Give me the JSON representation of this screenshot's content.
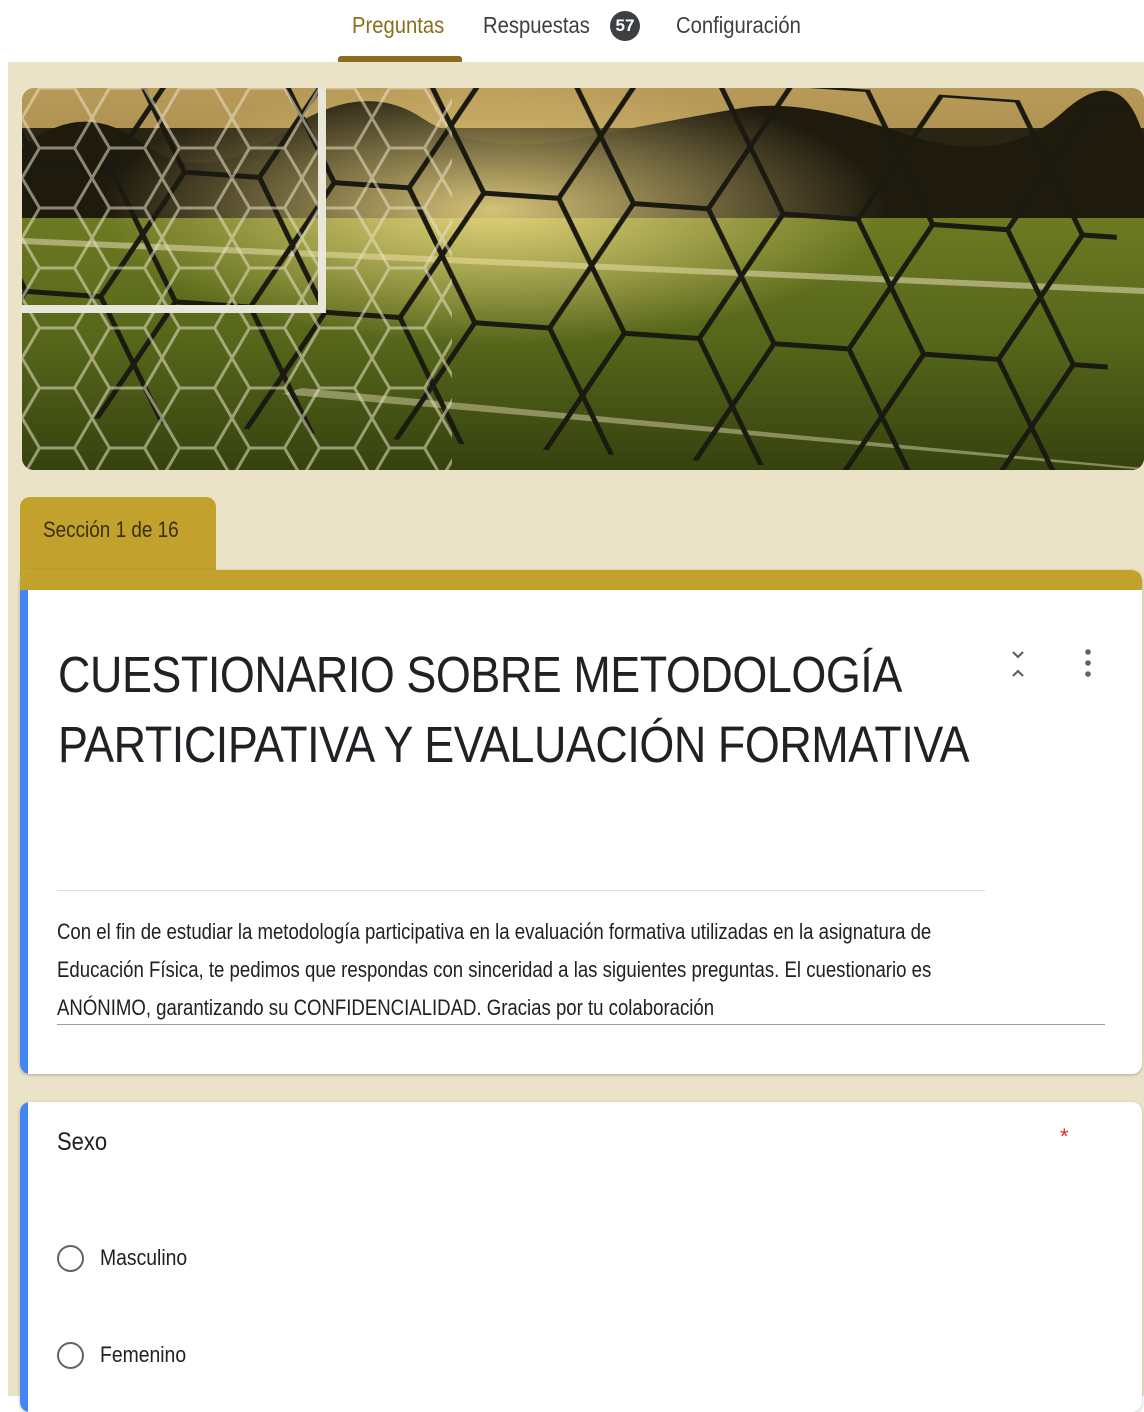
{
  "nav": {
    "tabs": [
      {
        "label": "Preguntas",
        "active": true
      },
      {
        "label": "Respuestas",
        "count": "57"
      },
      {
        "label": "Configuración"
      }
    ]
  },
  "section": {
    "label": "Sección 1 de 16"
  },
  "form": {
    "title_line1": "CUESTIONARIO SOBRE METODOLOGÍA",
    "title_line2": "PARTICIPATIVA Y EVALUACIÓN FORMATIVA",
    "description_line1": "Con el fin de estudiar la metodología participativa en la evaluación formativa utilizadas en la asignatura de",
    "description_line2": "Educación Física, te pedimos que respondas con sinceridad a las siguientes preguntas. El cuestionario es",
    "description_line3": "ANÓNIMO, garantizando su CONFIDENCIALIDAD. Gracias por tu colaboración"
  },
  "question": {
    "label": "Sexo",
    "required_mark": "*",
    "options": [
      "Masculino",
      "Femenino"
    ]
  },
  "icons": {
    "collapse": "collapse-icon",
    "more": "more-vert-icon",
    "banner": "soccer-net-banner"
  },
  "colors": {
    "theme_gold": "#c3a12d",
    "active_tab": "#8c6d1f",
    "background": "#ebe3c7",
    "accent_blue": "#4285f4",
    "required_red": "#d93025"
  }
}
